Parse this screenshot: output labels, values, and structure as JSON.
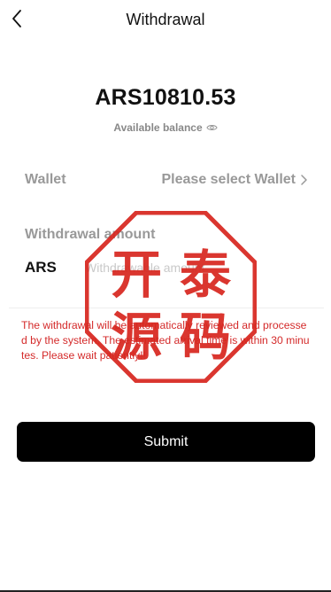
{
  "header": {
    "title": "Withdrawal"
  },
  "balance": {
    "amount": "ARS10810.53",
    "label": "Available balance"
  },
  "wallet": {
    "label": "Wallet",
    "placeholder_value": "Please select Wallet"
  },
  "amount": {
    "label": "Withdrawal amount",
    "currency": "ARS",
    "placeholder": "Withdrawable amount"
  },
  "notice": {
    "text": "The withdrawal will be automatically reviewed and processed by the system. The estimated arrival time is within 30 minutes. Please wait patiently!!"
  },
  "submit": {
    "label": "Submit"
  },
  "seal": {
    "chars": [
      "开",
      "泰",
      "源",
      "码"
    ]
  },
  "colors": {
    "accent": "#000000",
    "notice": "#d42a2a",
    "muted": "#999999",
    "seal": "#d7261e"
  }
}
